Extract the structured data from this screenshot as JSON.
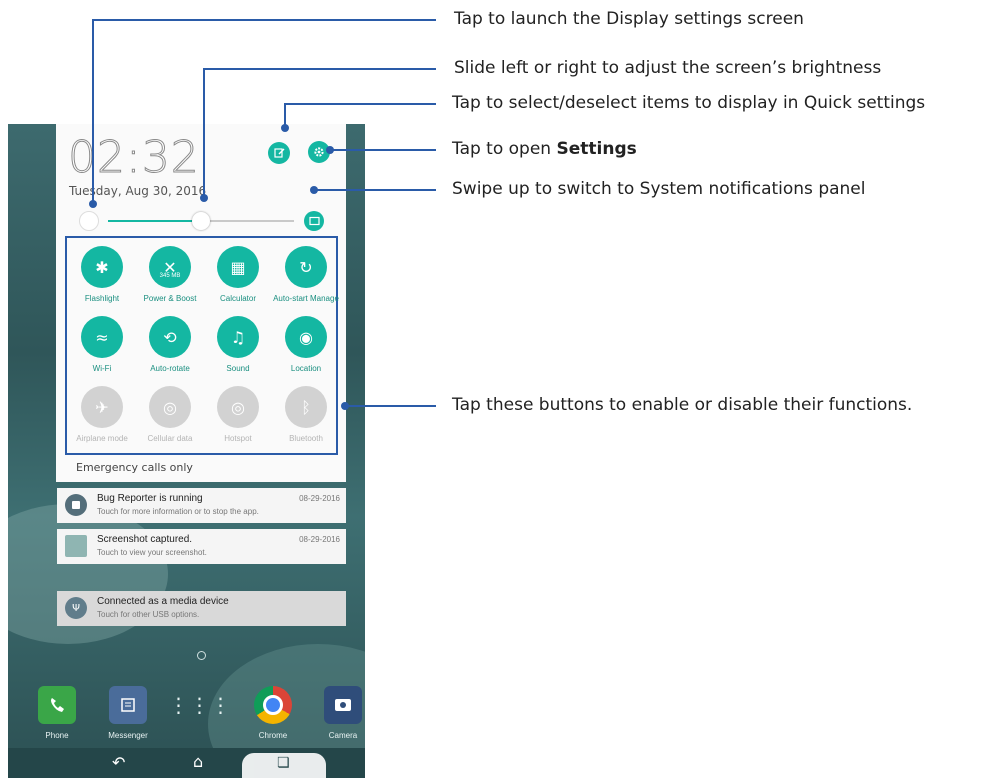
{
  "status": {
    "time": "02:32",
    "date": "Tuesday, Aug 30, 2016"
  },
  "quick_settings": {
    "brightness_level": 0.5,
    "tiles": [
      {
        "label": "Flashlight",
        "icon": "flashlight-icon",
        "state": "on"
      },
      {
        "label": "Power & Boost",
        "icon": "boost-icon",
        "state": "on",
        "badge": "345 MB"
      },
      {
        "label": "Calculator",
        "icon": "calculator-icon",
        "state": "on"
      },
      {
        "label": "Auto-start Manage",
        "icon": "autostart-icon",
        "state": "on"
      },
      {
        "label": "Wi-Fi",
        "icon": "wifi-icon",
        "state": "on"
      },
      {
        "label": "Auto-rotate",
        "icon": "rotate-icon",
        "state": "on"
      },
      {
        "label": "Sound",
        "icon": "sound-icon",
        "state": "on"
      },
      {
        "label": "Location",
        "icon": "location-icon",
        "state": "on"
      },
      {
        "label": "Airplane mode",
        "icon": "airplane-icon",
        "state": "off"
      },
      {
        "label": "Cellular data",
        "icon": "cellular-data-icon",
        "state": "off"
      },
      {
        "label": "Hotspot",
        "icon": "hotspot-icon",
        "state": "off"
      },
      {
        "label": "Bluetooth",
        "icon": "bluetooth-icon",
        "state": "off"
      }
    ],
    "emergency_text": "Emergency calls only"
  },
  "notifications": [
    {
      "title": "Bug Reporter is running",
      "subtitle": "Touch for more information or to stop the app.",
      "time": "08-29-2016",
      "icon": "stop-icon"
    },
    {
      "title": "Screenshot captured.",
      "subtitle": "Touch to view your screenshot.",
      "time": "08-29-2016",
      "icon": "screenshot-thumbnail-icon"
    },
    {
      "title": "Connected as a media device",
      "subtitle": "Touch for other USB options.",
      "time": "",
      "icon": "usb-icon"
    }
  ],
  "dock": [
    {
      "label": "Phone",
      "icon": "phone-icon",
      "color": "#3aa648"
    },
    {
      "label": "Messenger",
      "icon": "messenger-icon",
      "color": "#4a6c9a"
    },
    {
      "label": "",
      "icon": "app-drawer-icon",
      "color": ""
    },
    {
      "label": "Chrome",
      "icon": "chrome-icon",
      "color": ""
    },
    {
      "label": "Camera",
      "icon": "camera-icon",
      "color": "#2f4d7a"
    }
  ],
  "callouts": {
    "display_settings": "Tap to launch the Display settings screen",
    "brightness": "Slide left or right to adjust the screen’s brightness",
    "edit_quick_settings": "Tap to select/deselect items to display in Quick settings",
    "open_settings_prefix": "Tap to open ",
    "open_settings_bold": "Settings",
    "swipe_up": "Swipe up to switch to System notifications panel",
    "tiles": "Tap these buttons to enable or disable their functions."
  },
  "colors": {
    "accent": "#14b7a2",
    "callout_line": "#2a5ba8",
    "tile_off": "#d2d2d2"
  }
}
